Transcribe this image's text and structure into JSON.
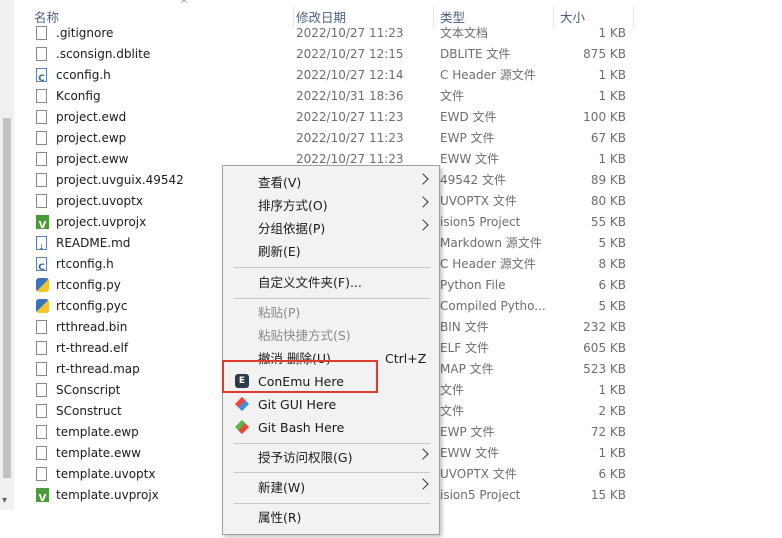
{
  "header": {
    "col_name": "名称",
    "col_date": "修改日期",
    "col_type": "类型",
    "col_size": "大小",
    "sort_glyph": "^"
  },
  "files": [
    {
      "name": ".gitignore",
      "date": "2022/10/27 11:23",
      "type": "文本文档",
      "size": "1 KB",
      "icon": "text-file-icon"
    },
    {
      "name": ".sconsign.dblite",
      "date": "2022/10/27 12:15",
      "type": "DBLITE 文件",
      "size": "875 KB",
      "icon": "file-icon"
    },
    {
      "name": "cconfig.h",
      "date": "2022/10/27 12:14",
      "type": "C Header 源文件",
      "size": "1 KB",
      "icon": "c-header-icon"
    },
    {
      "name": "Kconfig",
      "date": "2022/10/31 18:36",
      "type": "文件",
      "size": "1 KB",
      "icon": "file-icon"
    },
    {
      "name": "project.ewd",
      "date": "2022/10/27 11:23",
      "type": "EWD 文件",
      "size": "100 KB",
      "icon": "file-icon"
    },
    {
      "name": "project.ewp",
      "date": "2022/10/27 11:23",
      "type": "EWP 文件",
      "size": "67 KB",
      "icon": "file-icon"
    },
    {
      "name": "project.eww",
      "date": "2022/10/27 11:23",
      "type": "EWW 文件",
      "size": "1 KB",
      "icon": "file-icon"
    },
    {
      "name": "project.uvguix.49542",
      "date": "",
      "type": "49542 文件",
      "size": "89 KB",
      "icon": "file-icon"
    },
    {
      "name": "project.uvoptx",
      "date": "",
      "type": "UVOPTX 文件",
      "size": "80 KB",
      "icon": "file-icon"
    },
    {
      "name": "project.uvprojx",
      "date": "",
      "type": "ision5 Project",
      "size": "55 KB",
      "icon": "uvision-icon"
    },
    {
      "name": "README.md",
      "date": "",
      "type": "Markdown 源文件",
      "size": "5 KB",
      "icon": "markdown-icon"
    },
    {
      "name": "rtconfig.h",
      "date": "",
      "type": "C Header 源文件",
      "size": "8 KB",
      "icon": "c-header-icon"
    },
    {
      "name": "rtconfig.py",
      "date": "",
      "type": "Python File",
      "size": "6 KB",
      "icon": "python-icon"
    },
    {
      "name": "rtconfig.pyc",
      "date": "",
      "type": "Compiled Pytho...",
      "size": "5 KB",
      "icon": "python-icon"
    },
    {
      "name": "rtthread.bin",
      "date": "",
      "type": "BIN 文件",
      "size": "232 KB",
      "icon": "file-icon"
    },
    {
      "name": "rt-thread.elf",
      "date": "",
      "type": "ELF 文件",
      "size": "605 KB",
      "icon": "file-icon"
    },
    {
      "name": "rt-thread.map",
      "date": "",
      "type": "MAP 文件",
      "size": "523 KB",
      "icon": "file-icon"
    },
    {
      "name": "SConscript",
      "date": "",
      "type": "文件",
      "size": "1 KB",
      "icon": "file-icon"
    },
    {
      "name": "SConstruct",
      "date": "",
      "type": "文件",
      "size": "2 KB",
      "icon": "file-icon"
    },
    {
      "name": "template.ewp",
      "date": "",
      "type": "EWP 文件",
      "size": "72 KB",
      "icon": "file-icon"
    },
    {
      "name": "template.eww",
      "date": "",
      "type": "EWW 文件",
      "size": "1 KB",
      "icon": "file-icon"
    },
    {
      "name": "template.uvoptx",
      "date": "",
      "type": "UVOPTX 文件",
      "size": "6 KB",
      "icon": "file-icon"
    },
    {
      "name": "template.uvprojx",
      "date": "",
      "type": "ision5 Project",
      "size": "15 KB",
      "icon": "uvision-icon"
    }
  ],
  "context_menu": {
    "view": "查看(V)",
    "sort": "排序方式(O)",
    "group": "分组依据(P)",
    "refresh": "刷新(E)",
    "customize": "自定义文件夹(F)...",
    "paste": "粘贴(P)",
    "paste_shortcut": "粘贴快捷方式(S)",
    "undo_delete": "撤消 删除(U)",
    "undo_shortcut": "Ctrl+Z",
    "conemu": "ConEmu Here",
    "git_gui": "Git GUI Here",
    "git_bash": "Git Bash Here",
    "grant_access": "授予访问权限(G)",
    "new": "新建(W)",
    "properties": "属性(R)",
    "conemu_icon_glyph": "E"
  },
  "colors": {
    "highlight_border": "#e03a2e",
    "menu_background": "#f2f2f2",
    "header_text": "#4c607a"
  }
}
